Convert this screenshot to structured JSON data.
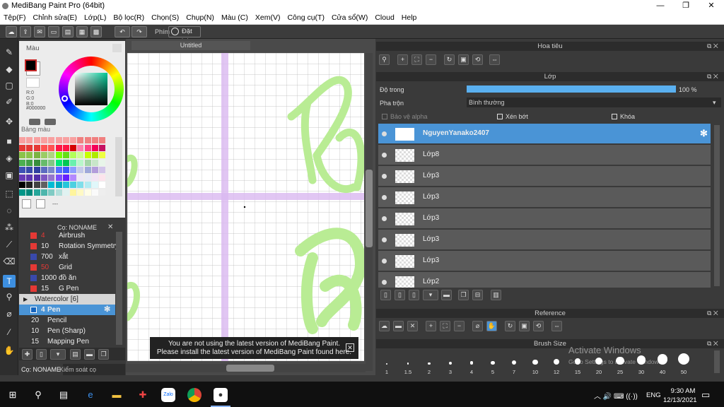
{
  "window": {
    "title": "MediBang Paint Pro (64bit)",
    "minimize": "—",
    "maximize": "❐",
    "close": "✕"
  },
  "menu": [
    "Tệp(F)",
    "Chỉnh sửa(E)",
    "Lớp(L)",
    "Bộ lọc(R)",
    "Chọn(S)",
    "Chụp(N)",
    "Màu (C)",
    "Xem(V)",
    "Công cụ(T)",
    "Cửa sổ(W)",
    "Cloud",
    "Help"
  ],
  "toolbar": {
    "phim_label": "Phím",
    "reset_label": "Đặt lại"
  },
  "color_panel": {
    "title": "Màu",
    "r": "R:0",
    "g": "G:0",
    "b": "B:0",
    "hex": "#000000"
  },
  "palette_panel": {
    "title": "Bảng màu",
    "extra": "---"
  },
  "brush_panel": {
    "title": "Cọ: NONAME",
    "items": [
      {
        "size": "4",
        "name": "Airbrush",
        "color": "#e53935"
      },
      {
        "size": "10",
        "name": "Rotation Symmetry",
        "color": "#e53935"
      },
      {
        "size": "700",
        "name": "xắt",
        "color": "#3949ab"
      },
      {
        "size": "50",
        "name": "Grid",
        "color": "#e53935"
      },
      {
        "size": "1000",
        "name": "đồ ăn",
        "color": "#3949ab"
      },
      {
        "size": "15",
        "name": "G Pen",
        "color": "#e53935"
      }
    ],
    "group": "Watercolor [6]",
    "items2": [
      {
        "size": "4",
        "name": "Pen",
        "color": "#1565c0"
      },
      {
        "size": "20",
        "name": "Pencil",
        "color": "#333333"
      },
      {
        "size": "10",
        "name": "Pen (Sharp)",
        "color": "#333333"
      },
      {
        "size": "15",
        "name": "Mapping Pen",
        "color": "#333333"
      }
    ],
    "tab1": "Cọ: NONAME",
    "tab2": "Kiểm soát cọ"
  },
  "canvas": {
    "tab": "Untitled",
    "grid_color": "#d9b8f0",
    "letter_color": "#b9ec94"
  },
  "notice": {
    "line1": "You are not using the latest version of MediBang Paint.",
    "line2": "Please install the latest version of MediBang Paint found here."
  },
  "navigator": {
    "title": "Hoa tiêu"
  },
  "layer_panel": {
    "title": "Lớp",
    "opacity_label": "Độ trong",
    "opacity_value": "100 %",
    "opacity": 1.0,
    "blend_label": "Pha trộn",
    "blend_value": "Bình thường",
    "protect_alpha": "Bảo vệ alpha",
    "clipping": "Xén bớt",
    "lock": "Khóa",
    "layers": [
      "NguyenYanako2407",
      "Lớp8",
      "Lớp3",
      "Lớp3",
      "Lớp3",
      "Lớp3",
      "Lớp3",
      "Lớp2"
    ]
  },
  "reference": {
    "title": "Reference"
  },
  "brush_size": {
    "title": "Brush Size",
    "sizes": [
      "1",
      "1.5",
      "2",
      "3",
      "4",
      "5",
      "7",
      "10",
      "12",
      "15",
      "20",
      "25",
      "30",
      "40",
      "50"
    ]
  },
  "watermark": {
    "line1": "Activate Windows",
    "line2": "Go to Settings to activate Windows."
  },
  "taskbar": {
    "lang": "ENG",
    "time": "9:30 AM",
    "date": "12/13/2021",
    "zalo": "Zalo"
  }
}
